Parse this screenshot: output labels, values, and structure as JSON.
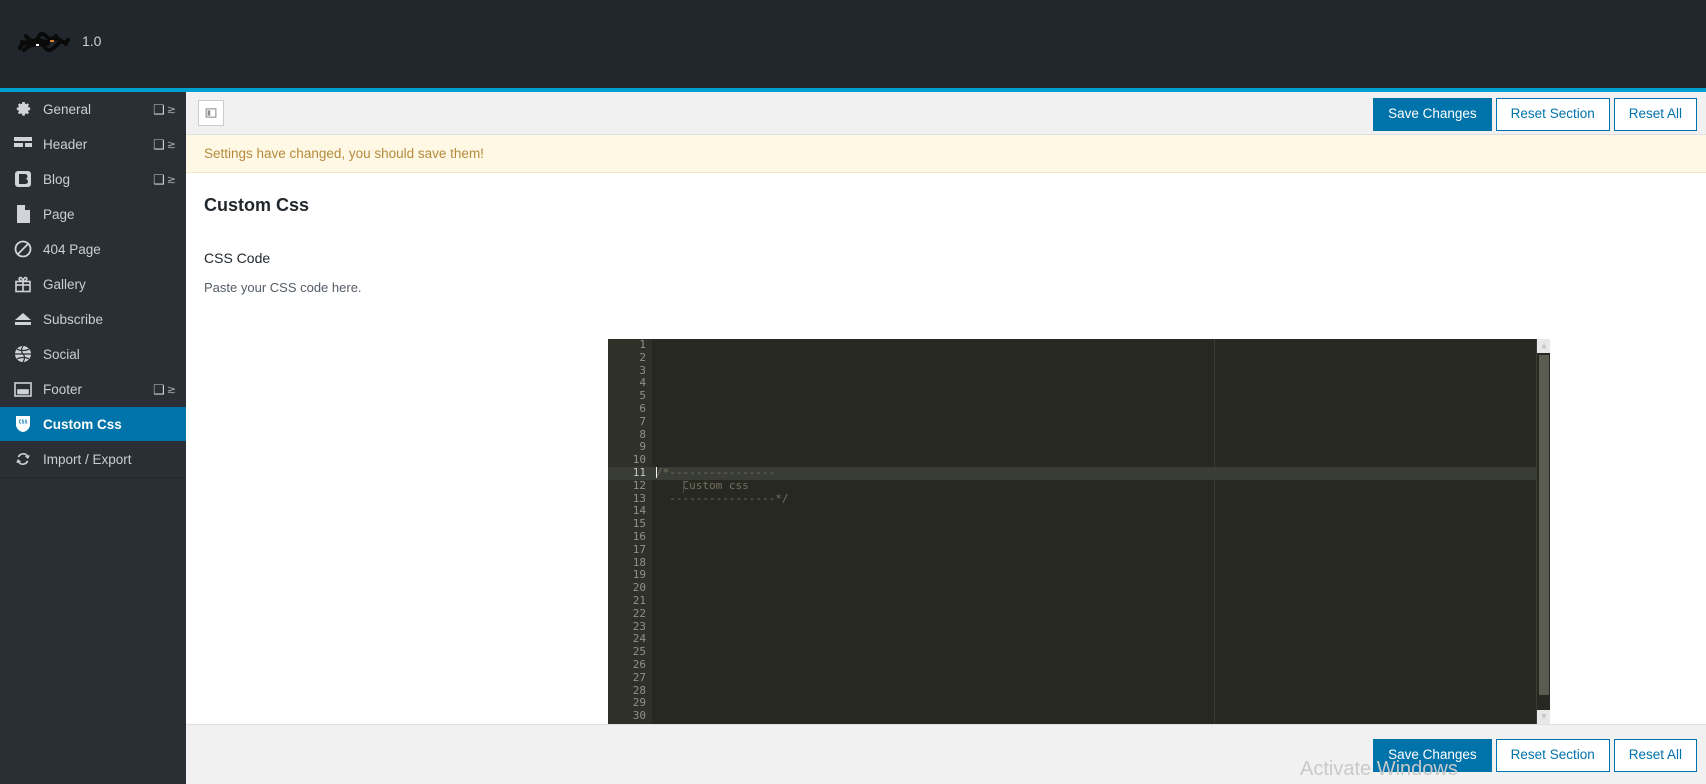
{
  "header": {
    "logo_icon": "scribbled-logo",
    "version": "1.0"
  },
  "sidebar": {
    "items": [
      {
        "label": "General",
        "icon": "gear-icon",
        "has_arrows": true,
        "active": false
      },
      {
        "label": "Header",
        "icon": "header-icon",
        "has_arrows": true,
        "active": false
      },
      {
        "label": "Blog",
        "icon": "blog-icon",
        "has_arrows": true,
        "active": false
      },
      {
        "label": "Page",
        "icon": "page-icon",
        "has_arrows": false,
        "active": false
      },
      {
        "label": "404 Page",
        "icon": "forbidden-icon",
        "has_arrows": false,
        "active": false
      },
      {
        "label": "Gallery",
        "icon": "gift-icon",
        "has_arrows": false,
        "active": false
      },
      {
        "label": "Subscribe",
        "icon": "eject-icon",
        "has_arrows": false,
        "active": false
      },
      {
        "label": "Social",
        "icon": "globe-icon",
        "has_arrows": false,
        "active": false
      },
      {
        "label": "Footer",
        "icon": "footer-icon",
        "has_arrows": true,
        "active": false
      },
      {
        "label": "Custom Css",
        "icon": "css-shield-icon",
        "has_arrows": false,
        "active": true
      },
      {
        "label": "Import / Export",
        "icon": "sync-icon",
        "has_arrows": false,
        "active": false
      }
    ]
  },
  "toolbar": {
    "expand_icon": "expand-panel-icon",
    "save_label": "Save Changes",
    "reset_section_label": "Reset Section",
    "reset_all_label": "Reset All"
  },
  "notice": {
    "text": "Settings have changed, you should save them!"
  },
  "panel": {
    "title": "Custom Css",
    "field_label": "CSS Code",
    "field_description": "Paste your CSS code here."
  },
  "editor": {
    "total_lines": 30,
    "active_line": 11,
    "line_numbers": [
      1,
      2,
      3,
      4,
      5,
      6,
      7,
      8,
      9,
      10,
      11,
      12,
      13,
      14,
      15,
      16,
      17,
      18,
      19,
      20,
      21,
      22,
      23,
      24,
      25,
      26,
      27,
      28,
      29,
      30
    ],
    "lines": [
      "",
      "",
      "",
      "",
      "",
      "",
      "",
      "",
      "",
      "",
      "/*----------------",
      "    Custom css",
      "  ----------------*/",
      "",
      "",
      "",
      "",
      "",
      "",
      "",
      "",
      "",
      "",
      "",
      "",
      "",
      "",
      "",
      "",
      ""
    ],
    "scroll_up_icon": "chevron-up-icon",
    "scroll_down_icon": "chevron-down-icon"
  },
  "footer": {
    "save_label": "Save Changes",
    "reset_section_label": "Reset Section",
    "reset_all_label": "Reset All"
  },
  "watermark": {
    "text": "Activate Windows"
  },
  "colors": {
    "accent": "#00a0d2",
    "sidebar_bg": "#2a2f35",
    "active_item": "#0073aa",
    "notice_bg": "#fff8e5",
    "notice_text": "#b58a3c",
    "editor_bg": "#272822"
  }
}
